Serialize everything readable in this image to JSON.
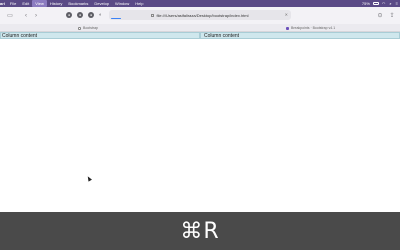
{
  "menubar": {
    "app_name": "ari",
    "menus": [
      "File",
      "Edit",
      "View",
      "History",
      "Bookmarks",
      "Develop",
      "Window",
      "Help"
    ],
    "active_menu": "View",
    "battery": "75%"
  },
  "toolbar": {
    "address": "file:///Users/asifaliraza/Desktop/bootstrap/index.html"
  },
  "tabs": [
    {
      "label": "Bootstrap"
    },
    {
      "label": "Breakpoints · Bootstrap v4.1"
    }
  ],
  "page": {
    "columns": [
      "Column content",
      "Column content"
    ]
  },
  "overlay": {
    "keys": "⌘R"
  },
  "colors": {
    "menubar_bg": "#5a4a86",
    "column_bg": "#cfe7ed",
    "overlay_bg": "#4a4a4a"
  }
}
